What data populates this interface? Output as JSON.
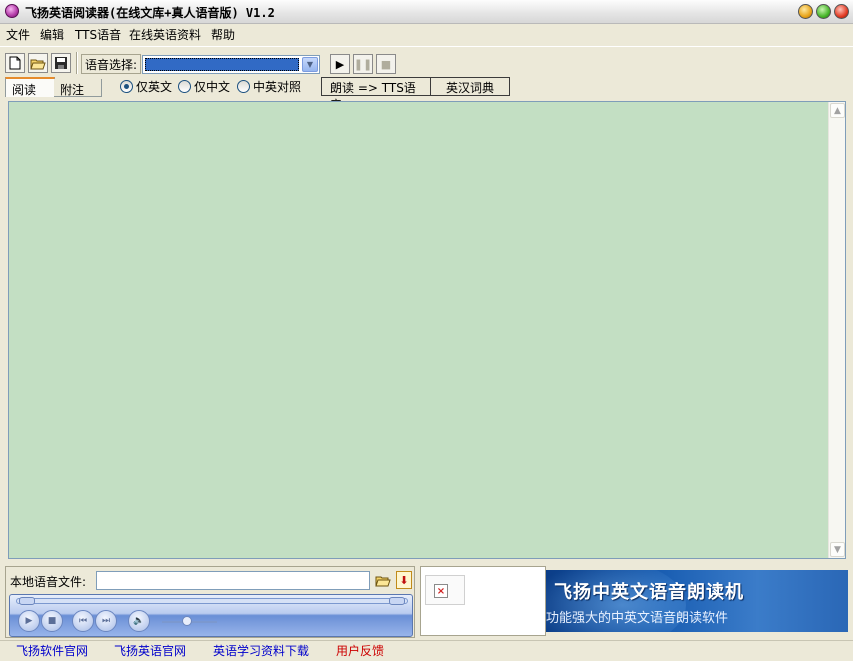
{
  "window": {
    "title": "飞扬英语阅读器(在线文库+真人语音版) V1.2"
  },
  "menu": {
    "items": [
      "文件",
      "编辑",
      "TTS语音",
      "在线英语资料",
      "帮助"
    ]
  },
  "toolbar": {
    "icons": [
      "new-file-icon",
      "open-folder-icon",
      "save-icon"
    ],
    "voice_label": "语音选择:",
    "voice_selected": "",
    "play_icons": [
      "play-icon",
      "pause-icon",
      "stop-icon"
    ]
  },
  "tabs": [
    "阅读",
    "附注"
  ],
  "language_options": [
    "仅英文",
    "仅中文",
    "中英对照"
  ],
  "language_selected": "仅英文",
  "mode_buttons": [
    "朗读 => TTS语音",
    "英汉词典"
  ],
  "content": {
    "text": "",
    "background": "#c3dfc3"
  },
  "local_file": {
    "label": "本地语音文件:",
    "value": ""
  },
  "banner": {
    "title": "飞扬中英文语音朗读机",
    "subtitle": "功能强大的中英文语音朗读软件"
  },
  "footer_links": [
    "飞扬软件官网",
    "飞扬英语官网",
    "英语学习资料下载",
    "用户反馈"
  ],
  "colors": {
    "accent": "#316ac5",
    "link": "#0000cc",
    "feedback_link": "#cc0000",
    "tab_highlight": "#e68b2c"
  }
}
